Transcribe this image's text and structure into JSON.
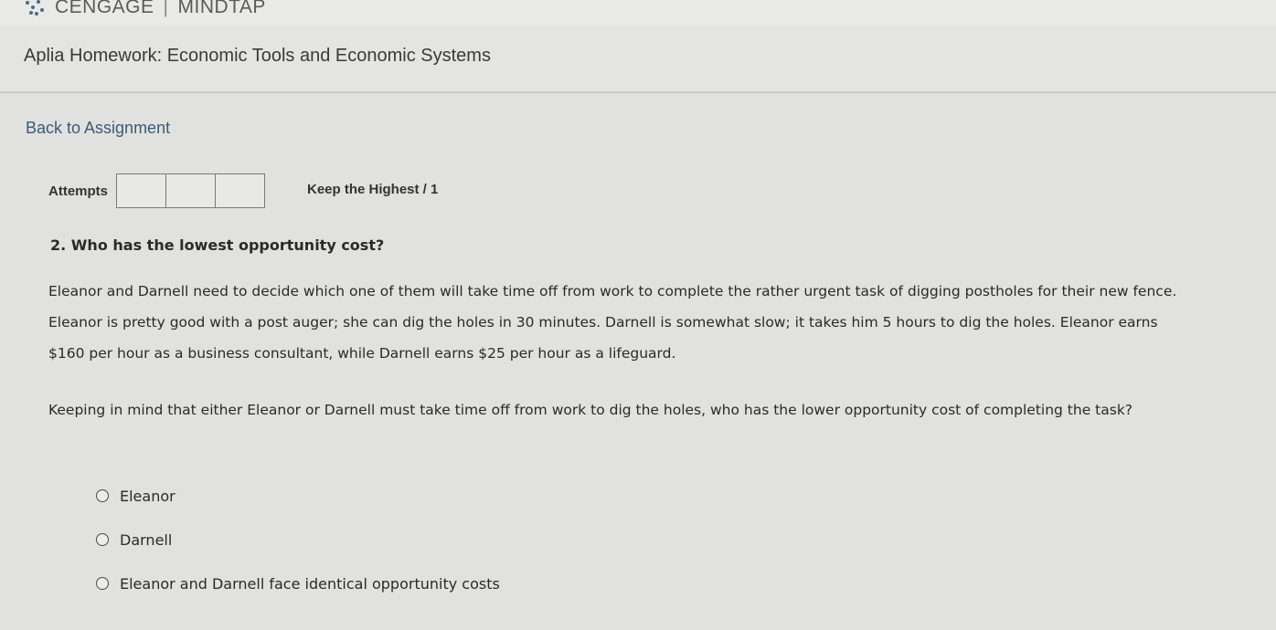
{
  "brand": {
    "name": "CENGAGE",
    "product": "MINDTAP",
    "separator": "|"
  },
  "header": {
    "title": "Aplia Homework: Economic Tools and Economic Systems"
  },
  "nav": {
    "back_label": "Back to Assignment"
  },
  "attempts": {
    "label": "Attempts",
    "keep_label": "Keep the Highest / 1",
    "box_count": 3
  },
  "question": {
    "title": "2. Who has the lowest opportunity cost?",
    "paragraph1": "Eleanor and Darnell need to decide which one of them will take time off from work to complete the rather urgent task of digging postholes for their new fence. Eleanor is pretty good with a post auger; she can dig the holes in 30 minutes. Darnell is somewhat slow; it takes him 5 hours to dig the holes. Eleanor earns $160 per hour as a business consultant, while Darnell earns $25 per hour as a lifeguard.",
    "paragraph2": "Keeping in mind that either Eleanor or Darnell must take time off from work to dig the holes, who has the lower opportunity cost of completing the task?",
    "options": [
      {
        "label": "Eleanor"
      },
      {
        "label": "Darnell"
      },
      {
        "label": "Eleanor and Darnell face identical opportunity costs"
      }
    ]
  }
}
